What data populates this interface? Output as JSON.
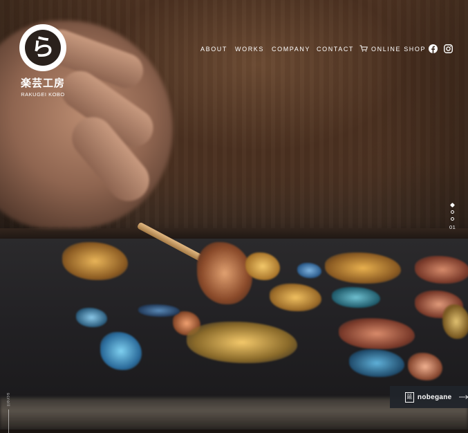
{
  "brand": {
    "logo_glyph": "ら",
    "name_jp": "楽芸工房",
    "name_en": "RAKUGEI KOBO"
  },
  "nav": {
    "items": [
      "ABOUT",
      "WORKS",
      "COMPANY",
      "CONTACT"
    ],
    "shop_label": "ONLINE SHOP",
    "cart_icon": "cart-icon",
    "facebook_icon": "facebook-icon",
    "instagram_icon": "instagram-icon"
  },
  "slider": {
    "slide_count": 3,
    "active_index": 0,
    "current_label": "01"
  },
  "scroll": {
    "label": "scroll"
  },
  "promo": {
    "kanji": "延",
    "label": "nobegane",
    "arrow_icon": "arrow-right-icon"
  },
  "colors": {
    "text": "#ffffff",
    "promo_bg": "#20242a"
  }
}
